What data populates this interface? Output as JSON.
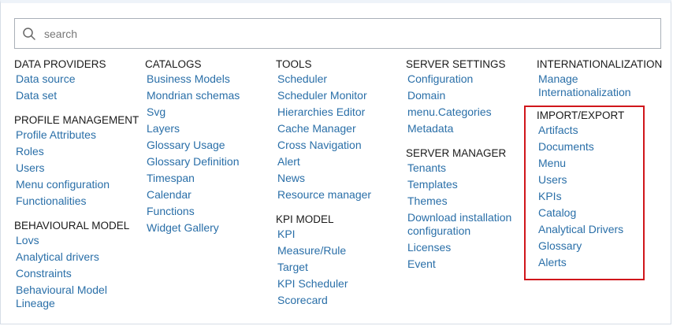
{
  "search": {
    "placeholder": "search",
    "icon": "search-icon"
  },
  "highlight_color": "#d0161b",
  "link_color": "#2a6fa8",
  "columns": [
    {
      "sections": [
        {
          "title": "DATA PROVIDERS",
          "items": [
            "Data source",
            "Data set"
          ]
        },
        {
          "title": "PROFILE MANAGEMENT",
          "items": [
            "Profile Attributes",
            "Roles",
            "Users",
            "Menu configuration",
            "Functionalities"
          ]
        },
        {
          "title": "BEHAVIOURAL MODEL",
          "items": [
            "Lovs",
            "Analytical drivers",
            "Constraints",
            "Behavioural Model Lineage"
          ]
        }
      ]
    },
    {
      "sections": [
        {
          "title": "CATALOGS",
          "items": [
            "Business Models",
            "Mondrian schemas",
            "Svg",
            "Layers",
            "Glossary Usage",
            "Glossary Definition",
            "Timespan",
            "Calendar",
            "Functions",
            "Widget Gallery"
          ]
        }
      ]
    },
    {
      "sections": [
        {
          "title": "TOOLS",
          "items": [
            "Scheduler",
            "Scheduler Monitor",
            "Hierarchies Editor",
            "Cache Manager",
            "Cross Navigation",
            "Alert",
            "News",
            "Resource manager"
          ]
        },
        {
          "title": "KPI MODEL",
          "items": [
            "KPI",
            "Measure/Rule",
            "Target",
            "KPI Scheduler",
            "Scorecard"
          ]
        }
      ]
    },
    {
      "sections": [
        {
          "title": "SERVER SETTINGS",
          "items": [
            "Configuration",
            "Domain",
            "menu.Categories",
            "Metadata"
          ]
        },
        {
          "title": "SERVER MANAGER",
          "items": [
            "Tenants",
            "Templates",
            "Themes",
            "Download installation configuration",
            "Licenses",
            "Event"
          ]
        }
      ]
    },
    {
      "sections": [
        {
          "title": "INTERNATIONALIZATION",
          "items": [
            "Manage Internationalization"
          ]
        },
        {
          "title": "IMPORT/EXPORT",
          "items": [
            "Artifacts",
            "Documents",
            "Menu",
            "Users",
            "KPIs",
            "Catalog",
            "Analytical Drivers",
            "Glossary",
            "Alerts"
          ]
        }
      ]
    }
  ]
}
